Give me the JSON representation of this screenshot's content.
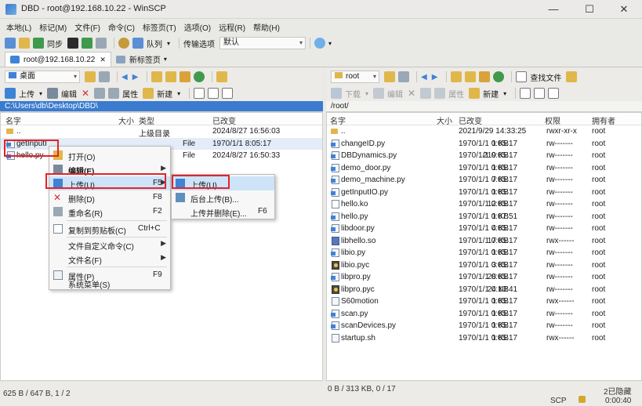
{
  "window": {
    "title": "DBD - root@192.168.10.22 - WinSCP",
    "controls": [
      "—",
      "☐",
      "✕"
    ]
  },
  "menubar": [
    "本地(L)",
    "标记(M)",
    "文件(F)",
    "命令(C)",
    "标签页(T)",
    "选项(O)",
    "远程(R)",
    "帮助(H)"
  ],
  "toolbar": {
    "sync": "同步",
    "queue": "队列",
    "transfer_options": "传输选项",
    "transfer_preset": "默认"
  },
  "tabs": [
    {
      "label": "root@192.168.10.22",
      "close": "✕"
    },
    {
      "label": "新标签页"
    }
  ],
  "left": {
    "drive": "桌面",
    "actions": {
      "upload": "上传",
      "edit": "编辑",
      "properties": "属性",
      "new": "新建"
    },
    "path": "C:\\Users\\db\\Desktop\\DBD\\",
    "columns": {
      "name": "名字",
      "size": "大小",
      "type": "类型",
      "changed": "已改变"
    },
    "files": [
      {
        "name": "..",
        "size": "",
        "type": "上级目录",
        "changed": "2024/8/27  16:56:03",
        "kind": "up"
      },
      {
        "name": "getInputI",
        "size": "",
        "type": "File",
        "changed": "1970/1/1   8:05:17",
        "kind": "py"
      },
      {
        "name": "hello.py",
        "size": "",
        "type": "File",
        "changed": "2024/8/27  16:50:33",
        "kind": "py"
      }
    ],
    "status": "625 B / 647 B,  1 / 2"
  },
  "right": {
    "drive": "root",
    "actions": {
      "download": "下载",
      "edit": "编辑",
      "properties": "属性",
      "new": "新建",
      "find": "查找文件"
    },
    "path": "/root/",
    "columns": {
      "name": "名字",
      "size": "大小",
      "changed": "已改变",
      "rights": "权限",
      "owner": "拥有者"
    },
    "files": [
      {
        "name": "..",
        "size": "",
        "changed": "2021/9/29 14:33:25",
        "rights": "rwxr-xr-x",
        "owner": "root",
        "kind": "up"
      },
      {
        "name": "changeID.py",
        "size": "1 KB",
        "changed": "1970/1/1 0:05:17",
        "rights": "rw-------",
        "owner": "root",
        "kind": "py"
      },
      {
        "name": "DBDynamics.py",
        "size": "219 KB",
        "changed": "1970/1/1 0:05:17",
        "rights": "rw-------",
        "owner": "root",
        "kind": "py"
      },
      {
        "name": "demo_door.py",
        "size": "1 KB",
        "changed": "1970/1/1 0:05:17",
        "rights": "rw-------",
        "owner": "root",
        "kind": "py"
      },
      {
        "name": "demo_machine.py",
        "size": "7 KB",
        "changed": "1970/1/1 0:05:17",
        "rights": "rw-------",
        "owner": "root",
        "kind": "py"
      },
      {
        "name": "getInputIO.py",
        "size": "1 KB",
        "changed": "1970/1/1 0:05:17",
        "rights": "rw-------",
        "owner": "root",
        "kind": "py"
      },
      {
        "name": "hello.ko",
        "size": "12 KB",
        "changed": "1970/1/1 0:05:17",
        "rights": "rw-------",
        "owner": "root",
        "kind": "ko"
      },
      {
        "name": "hello.py",
        "size": "1 KB",
        "changed": "1970/1/1 0:07:51",
        "rights": "rw-------",
        "owner": "root",
        "kind": "py"
      },
      {
        "name": "libdoor.py",
        "size": "4 KB",
        "changed": "1970/1/1 0:05:17",
        "rights": "rw-------",
        "owner": "root",
        "kind": "py"
      },
      {
        "name": "libhello.so",
        "size": "17 KB",
        "changed": "1970/1/1 0:05:17",
        "rights": "rwx------",
        "owner": "root",
        "kind": "so"
      },
      {
        "name": "libio.py",
        "size": "1 KB",
        "changed": "1970/1/1 0:05:17",
        "rights": "rw-------",
        "owner": "root",
        "kind": "py"
      },
      {
        "name": "libio.pyc",
        "size": "3 KB",
        "changed": "1970/1/1 0:05:17",
        "rights": "rw-------",
        "owner": "root",
        "kind": "pyc"
      },
      {
        "name": "libpro.py",
        "size": "28 KB",
        "changed": "1970/1/1 0:05:17",
        "rights": "rw-------",
        "owner": "root",
        "kind": "py"
      },
      {
        "name": "libpro.pyc",
        "size": "24 KB",
        "changed": "1970/1/1 0:10:41",
        "rights": "rw-------",
        "owner": "root",
        "kind": "pyc"
      },
      {
        "name": "S60motion",
        "size": "1 KB",
        "changed": "1970/1/1 0:05:17",
        "rights": "rwx------",
        "owner": "root",
        "kind": "file"
      },
      {
        "name": "scan.py",
        "size": "1 KB",
        "changed": "1970/1/1 0:05:17",
        "rights": "rw-------",
        "owner": "root",
        "kind": "py"
      },
      {
        "name": "scanDevices.py",
        "size": "1 KB",
        "changed": "1970/1/1 0:05:17",
        "rights": "rw-------",
        "owner": "root",
        "kind": "py"
      },
      {
        "name": "startup.sh",
        "size": "1 KB",
        "changed": "1970/1/1 0:05:17",
        "rights": "rwx------",
        "owner": "root",
        "kind": "file"
      }
    ],
    "status": "0 B / 313 KB,  0 / 17",
    "hidden": "2已隐藏"
  },
  "statusbar": {
    "protocol": "SCP",
    "time": "0:00:40"
  },
  "context_menu": {
    "items": [
      {
        "label": "打开(O)",
        "shortcut": "",
        "sub": false
      },
      {
        "label": "编辑(E)",
        "shortcut": "",
        "sub": true
      },
      {
        "label": "上传(U)...",
        "shortcut": "F5",
        "sub": true
      },
      {
        "label": "删除(D)",
        "shortcut": "F8",
        "sub": false
      },
      {
        "label": "重命名(R)",
        "shortcut": "F2",
        "sub": false
      },
      {
        "label": "复制到剪贴板(C)",
        "shortcut": "Ctrl+C",
        "sub": false
      },
      {
        "label": "文件自定义命令(C)",
        "shortcut": "",
        "sub": true
      },
      {
        "label": "文件名(F)",
        "shortcut": "",
        "sub": true
      },
      {
        "label": "属性(P)",
        "shortcut": "F9",
        "sub": false
      },
      {
        "label": "系统菜单(S)",
        "shortcut": "",
        "sub": false
      }
    ]
  },
  "submenu": {
    "items": [
      {
        "label": "上传(U)...",
        "shortcut": ""
      },
      {
        "label": "后台上传(B)...",
        "shortcut": ""
      },
      {
        "label": "上传并删除(E)...",
        "shortcut": "F6"
      }
    ]
  }
}
